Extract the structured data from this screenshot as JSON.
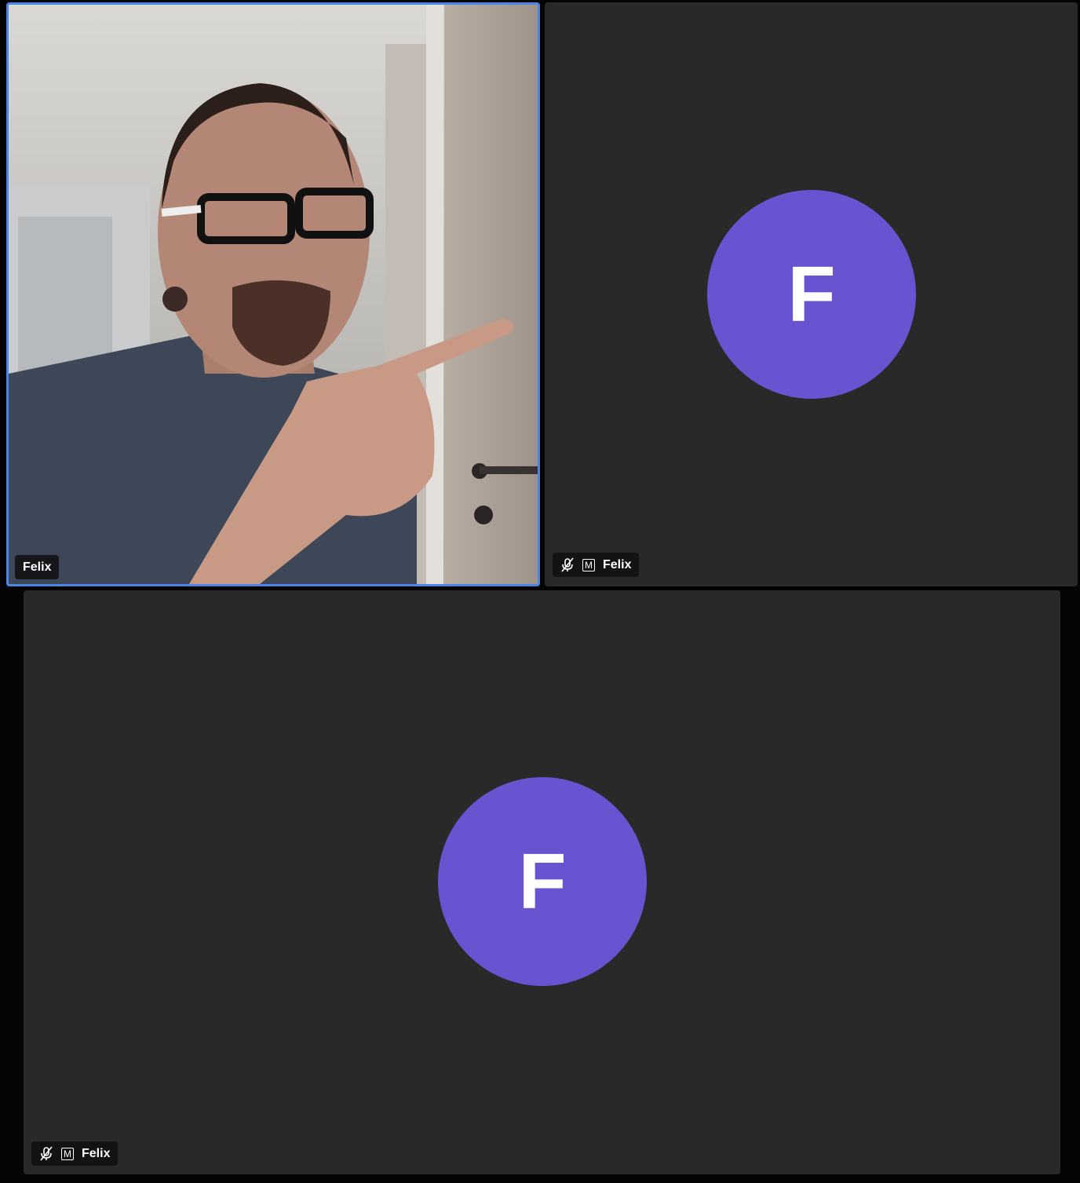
{
  "participants": [
    {
      "name": "Felix",
      "video_on": true,
      "muted": false
    },
    {
      "name": "Felix",
      "initial": "F",
      "video_on": false,
      "muted": true,
      "badge": "M"
    },
    {
      "name": "Felix",
      "initial": "F",
      "video_on": false,
      "muted": true,
      "badge": "M"
    }
  ],
  "colors": {
    "avatar_bg": "#6a53d1",
    "tile_bg": "#292929",
    "active_speaker_border": "#4a86e8",
    "page_bg": "#040404"
  },
  "icons": {
    "muted": "mic-off-icon",
    "moderator": "moderator-badge-icon"
  }
}
